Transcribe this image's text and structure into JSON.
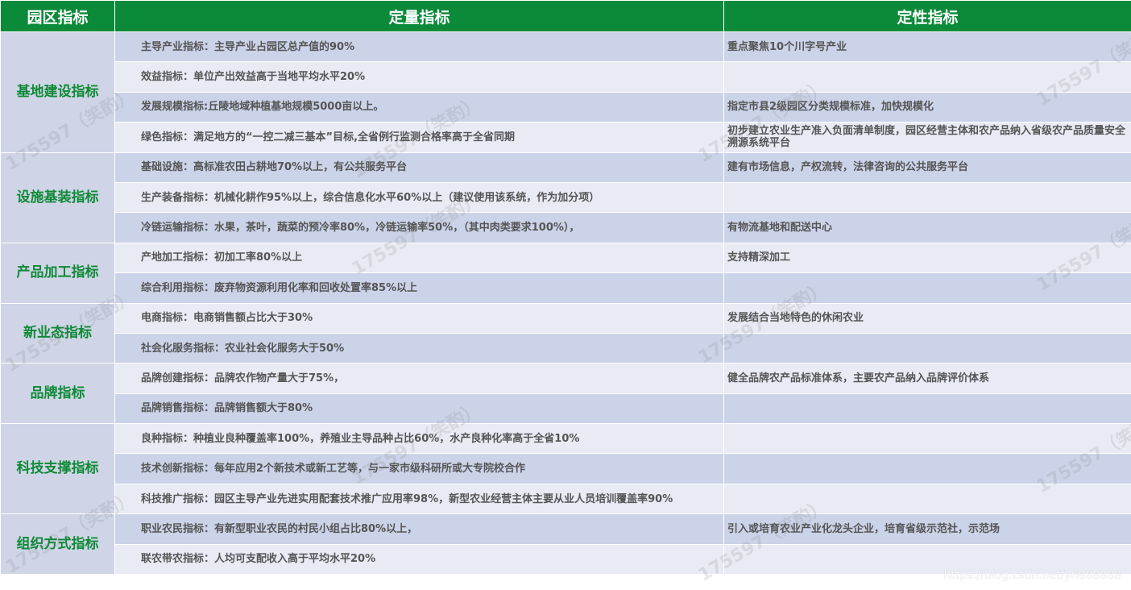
{
  "header": {
    "col1": "园区指标",
    "col2": "定量指标",
    "col3": "定性指标"
  },
  "groups": [
    {
      "category": "基地建设指标",
      "rows": [
        {
          "quant": "主导产业指标：主导产业占园区总产值的90%",
          "qual": "重点聚焦10个川字号产业"
        },
        {
          "quant": "效益指标：单位产出效益高于当地平均水平20%",
          "qual": ""
        },
        {
          "quant": "发展规模指标:丘陵地域种植基地规模5000亩以上。",
          "qual": "指定市县2级园区分类规模标准，加快规模化"
        },
        {
          "quant": "绿色指标：满足地方的“一控二减三基本”目标,全省例行监测合格率高于全省同期",
          "qual": "初步建立农业生产准入负面清单制度，园区经营主体和农产品纳入省级农产品质量安全溯源系统平台"
        }
      ]
    },
    {
      "category": "设施基装指标",
      "rows": [
        {
          "quant": "基础设施：高标准农田占耕地70%以上，有公共服务平台",
          "qual": "建有市场信息，产权流转，法律咨询的公共服务平台"
        },
        {
          "quant": "生产装备指标：机械化耕作95%以上，综合信息化水平60%以上（建议使用该系统，作为加分项）",
          "qual": ""
        },
        {
          "quant": "冷链运输指标：水果，茶叶，蔬菜的预冷率80%，冷链运输率50%，（其中肉类要求100%），",
          "qual": "有物流基地和配送中心"
        }
      ]
    },
    {
      "category": "产品加工指标",
      "rows": [
        {
          "quant": "产地加工指标：初加工率80%以上",
          "qual": "支持精深加工"
        },
        {
          "quant": "综合利用指标：废弃物资源利用化率和回收处置率85%以上",
          "qual": ""
        }
      ]
    },
    {
      "category": "新业态指标",
      "rows": [
        {
          "quant": "电商指标：电商销售额占比大于30%",
          "qual": "发展结合当地特色的休闲农业"
        },
        {
          "quant": "社会化服务指标：农业社会化服务大于50%",
          "qual": ""
        }
      ]
    },
    {
      "category": "品牌指标",
      "rows": [
        {
          "quant": "品牌创建指标：品牌农作物产量大于75%，",
          "qual": "健全品牌农产品标准体系，主要农产品纳入品牌评价体系"
        },
        {
          "quant": "品牌销售指标：品牌销售额大于80%",
          "qual": ""
        }
      ]
    },
    {
      "category": "科技支撑指标",
      "rows": [
        {
          "quant": "良种指标：种植业良种覆盖率100%，养殖业主导品种占比60%，水产良种化率高于全省10%",
          "qual": ""
        },
        {
          "quant": "技术创新指标：每年应用2个新技术或新工艺等，与一家市级科研所或大专院校合作",
          "qual": ""
        },
        {
          "quant": "科技推广指标：园区主导产业先进实用配套技术推广应用率98%，新型农业经营主体主要从业人员培训覆盖率90%",
          "qual": ""
        }
      ]
    },
    {
      "category": "组织方式指标",
      "rows": [
        {
          "quant": "职业农民指标：有新型职业农民的村民小组占比80%以上，",
          "qual": "引入或培育农业产业化龙头企业，培育省级示范社，示范场"
        },
        {
          "quant": "联农带农指标：人均可支配收入高于平均水平20%",
          "qual": ""
        }
      ]
    }
  ],
  "watermark": "175597（笑酌）",
  "source_url": "https://blog.csdn.net/yn888888"
}
